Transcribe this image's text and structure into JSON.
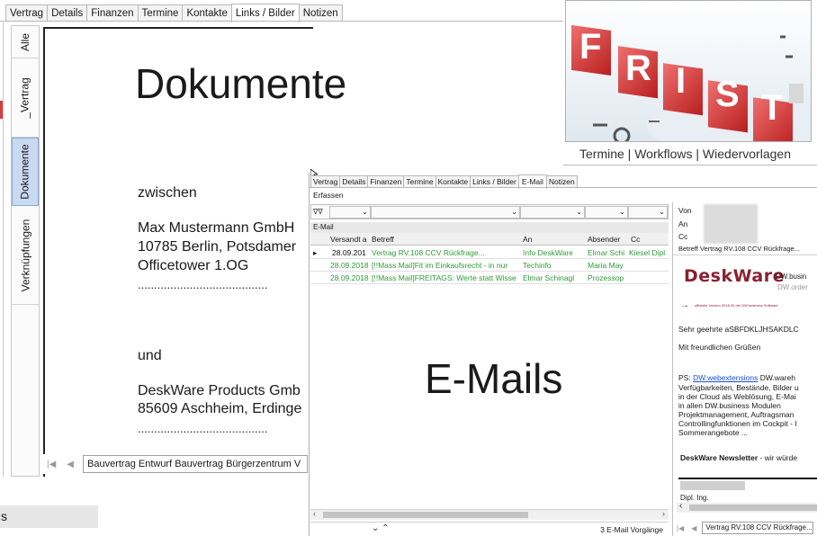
{
  "bg_tabs": [
    "Vertrag",
    "Details",
    "Finanzen",
    "Termine",
    "Kontakte",
    "Links / Bilder",
    "Notizen"
  ],
  "bg_active_tab": 5,
  "side_tabs": [
    "Alle",
    "_Vertrag",
    "Dokumente",
    "Verknüpfungen"
  ],
  "doc": {
    "title": "Dokumente",
    "line1": "zwischen",
    "line2": "Max Mustermann GmbH",
    "line3": "10785 Berlin, Potsdamer",
    "line4": "Officetower 1.OG",
    "dots1": "........................................",
    "line5": "und",
    "line6": "DeskWare Products Gmb",
    "line7": "85609 Aschheim, Erdinge",
    "dots2": "........................................"
  },
  "doc_nav": {
    "label": "Bauvertrag Entwurf Bauvertrag Bürgerzentrum V"
  },
  "bottom_left": {
    "label": "s"
  },
  "frist": {
    "image_word": "FRIST",
    "caption": "Termine  | Workflows | Wiedervorlagen"
  },
  "email": {
    "tabs": [
      "Vertrag",
      "Details",
      "Finanzen",
      "Termine",
      "Kontakte",
      "Links / Bilder",
      "E-Mail",
      "Notizen"
    ],
    "active_tab": 6,
    "erfassen": "Erfassen",
    "grid_caption": "E-Mail",
    "columns": [
      "Versandt a",
      "Betreff",
      "An",
      "Absender",
      "Cc"
    ],
    "rows": [
      {
        "date": "28.09.201",
        "subject": "Vertrag RV.108 CCV Rückfrage...",
        "to": "Info DeskWare",
        "from": "Elmar Schi",
        "cc": "Kiesel Dipl"
      },
      {
        "date": "28.09.2018",
        "subject": "[!!Mass Mail]Fit im Einkaufsrecht - in nur",
        "to": "Techinfo",
        "from": "Maria May",
        "cc": ""
      },
      {
        "date": "28.09.2018",
        "subject": "[!!Mass Mail]FREITAGS: Werte statt Wisse",
        "to": "Elmar Schinagl",
        "from": "Prozessop",
        "cc": ""
      }
    ],
    "overlay": "E-Mails",
    "status": "3 E-Mail Vorgänge",
    "preview": {
      "von_label": "Von",
      "an_label": "An",
      "cc_label": "Cc",
      "betreff": "Betreff  Vertrag RV.108 CCV Rückfrage...",
      "logo": "DeskWare",
      "logo_right1": "DW.busin",
      "logo_right2": "DW.order",
      "small_line": "offizielle Version 2018.20 der DW.business Software",
      "greeting": "Sehr geehrte aSBFDKLJHSAKDLC",
      "closing": "Mit freundlichen Grüßen",
      "ps_prefix": "PS: ",
      "ps_link": "DW.webextensions",
      "ps_rest": " DW.wareh",
      "p2": "Verfügbarkeiten, Bestände, Bilder u",
      "p3": "in der Cloud als Weblösung, E-Mai",
      "p4": "in allen DW.business Modulen",
      "p5": "Projektmanagement, Auftragsman",
      "p6": "Controllingfunktionen im Cockpit - I",
      "p7": "Sommerangebote ...",
      "newsletter_bold": "DeskWare Newsletter",
      "newsletter_rest": " - wir würde",
      "sign": "Dipl. Ing.",
      "nav_label": "Vertrag RV.108 CCV Rückfrage..."
    }
  },
  "colors": {
    "green_text": "#2e9a3a",
    "vtab_active": "#c9daf0",
    "link": "#1a4fd6",
    "brand": "#8a2030"
  }
}
